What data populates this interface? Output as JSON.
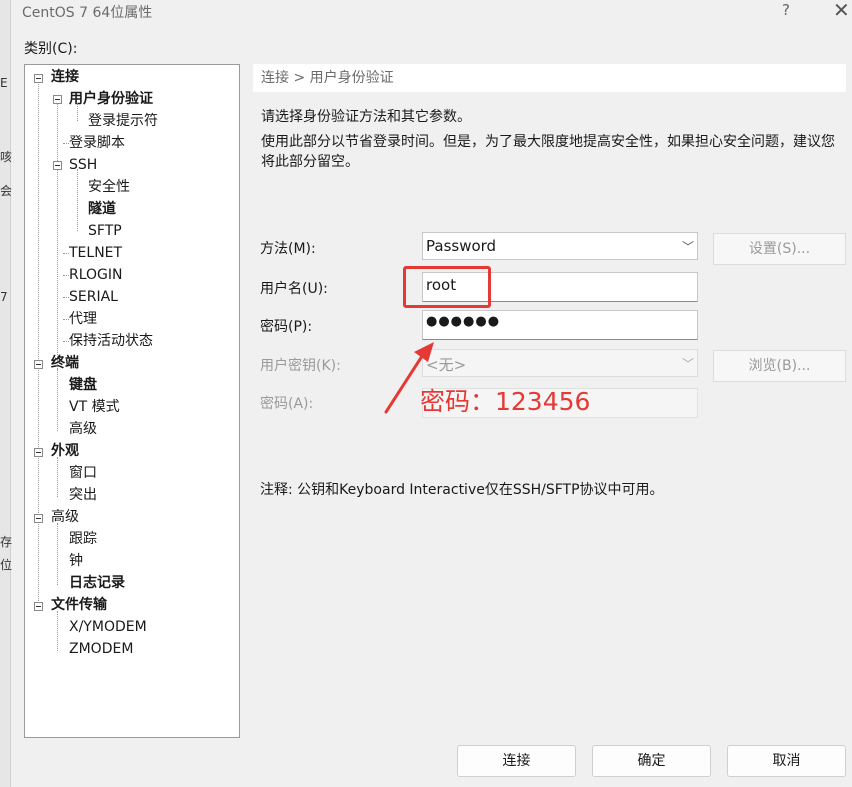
{
  "window": {
    "title": "CentOS 7 64位属性",
    "help_glyph": "?",
    "close_glyph": "✕"
  },
  "background_strip": {
    "glyphs": [
      "E",
      "咳",
      "会",
      "7",
      "存",
      "位"
    ]
  },
  "category": {
    "label": "类别(C):",
    "tree": [
      {
        "label": "连接",
        "expander": true
      },
      {
        "label": "用户身份验证",
        "expander": true
      },
      {
        "label": "登录提示符"
      },
      {
        "label": "登录脚本"
      },
      {
        "label": "SSH",
        "expander": true
      },
      {
        "label": "安全性"
      },
      {
        "label": "隧道"
      },
      {
        "label": "SFTP"
      },
      {
        "label": "TELNET"
      },
      {
        "label": "RLOGIN"
      },
      {
        "label": "SERIAL"
      },
      {
        "label": "代理"
      },
      {
        "label": "保持活动状态"
      },
      {
        "label": "终端",
        "expander": true
      },
      {
        "label": "键盘"
      },
      {
        "label": "VT 模式"
      },
      {
        "label": "高级"
      },
      {
        "label": "外观",
        "expander": true
      },
      {
        "label": "窗口"
      },
      {
        "label": "突出"
      },
      {
        "label": "高级",
        "expander": true
      },
      {
        "label": "跟踪"
      },
      {
        "label": "钟"
      },
      {
        "label": "日志记录"
      },
      {
        "label": "文件传输",
        "expander": true
      },
      {
        "label": "X/YMODEM"
      },
      {
        "label": "ZMODEM"
      }
    ]
  },
  "panel": {
    "breadcrumb": "连接 > 用户身份验证",
    "intro": "请选择身份验证方法和其它参数。",
    "description": "使用此部分以节省登录时间。但是，为了最大限度地提高安全性，如果担心安全问题，建议您将此部分留空。",
    "method": {
      "label": "方法(M):",
      "value": "Password",
      "settings_button": "设置(S)..."
    },
    "username": {
      "label": "用户名(U):",
      "value": "root"
    },
    "password": {
      "label": "密码(P):",
      "value": "●●●●●●"
    },
    "user_key": {
      "label": "用户密钥(K):",
      "value": "<无>",
      "browse_button": "浏览(B)..."
    },
    "passphrase": {
      "label": "密码(A):",
      "value": ""
    },
    "note": "注释: 公钥和Keyboard Interactive仅在SSH/SFTP协议中可用。"
  },
  "annotation": {
    "text": "密码：123456",
    "color": "#e53935"
  },
  "buttons": {
    "connect": "连接",
    "ok": "确定",
    "cancel": "取消"
  }
}
